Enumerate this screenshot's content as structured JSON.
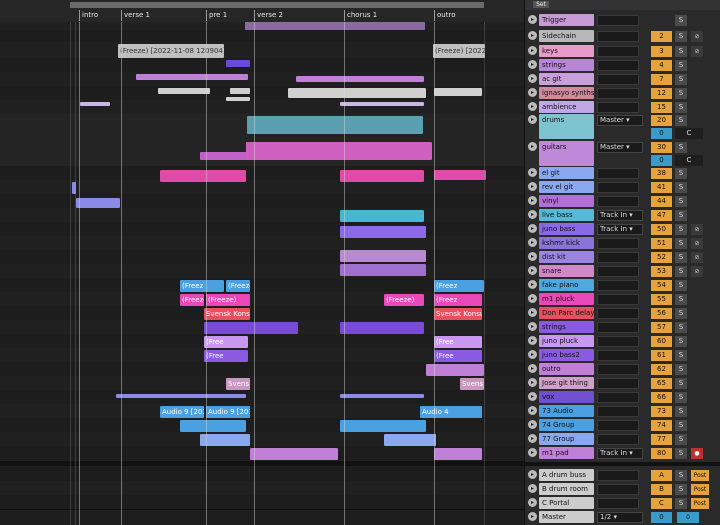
{
  "locators": [
    {
      "label": "intro"
    },
    {
      "label": "verse 1"
    },
    {
      "label": "pre 1"
    },
    {
      "label": "verse 2"
    },
    {
      "label": "chorus 1"
    },
    {
      "label": "outro"
    }
  ],
  "clip_labels": {
    "keys_freeze": "(Freeze) [2022-11-08 120904]",
    "keys_freeze2": "(Freeze) [2022",
    "freeze_a": "(Freez",
    "freeze_b": "(Freeze)",
    "freeze_c": "(Freez",
    "freeze_d": "(Freeze)",
    "freeze_e": "(Freeze)",
    "freeze_f": "(Freez",
    "svensk1": "Svensk Konsult",
    "svensk2": "Svensk Konsult",
    "freeze_g": "(Free",
    "freeze_h": "(Free",
    "freeze_i": "(Free",
    "freeze_j": "(Free",
    "svens": "Svens",
    "svens2": "Svens",
    "audio9a": "Audio 9 [2022",
    "audio9b": "Audio 9 [2022",
    "audio4": "Audio 4"
  },
  "mixer": {
    "set_label": "Set",
    "tracks": [
      {
        "name": "Trigger",
        "num": "",
        "color": "#c89ad6",
        "solo": "S",
        "extra": ""
      },
      {
        "name": "Sidechain",
        "num": "2",
        "color": "#b8b8b8",
        "solo": "S",
        "extra": "⊘"
      },
      {
        "name": "keys",
        "num": "3",
        "color": "#e89ac8",
        "solo": "S",
        "extra": "⊘"
      },
      {
        "name": "strings",
        "num": "4",
        "color": "#b886d8",
        "solo": "S",
        "extra": ""
      },
      {
        "name": "ac git",
        "num": "7",
        "color": "#c9a0dc",
        "solo": "S",
        "extra": ""
      },
      {
        "name": "ignasyo synths",
        "num": "12",
        "color": "#d08aa0",
        "solo": "S",
        "extra": ""
      },
      {
        "name": "ambience",
        "num": "15",
        "color": "#c0a8e8",
        "solo": "S",
        "extra": ""
      },
      {
        "name": "drums",
        "num": "20",
        "color": "#7ec4d0",
        "solo": "S",
        "extra": "",
        "route": "Master"
      },
      {
        "name": "guitars",
        "num": "30",
        "color": "#c088d8",
        "solo": "S",
        "extra": "",
        "route": "Master"
      },
      {
        "name": "el git",
        "num": "38",
        "color": "#8aa8f0",
        "solo": "S",
        "extra": ""
      },
      {
        "name": "rev el git",
        "num": "41",
        "color": "#8aa8f0",
        "solo": "S",
        "extra": ""
      },
      {
        "name": "vinyl",
        "num": "44",
        "color": "#b070d8",
        "solo": "S",
        "extra": ""
      },
      {
        "name": "live bass",
        "num": "47",
        "color": "#58b8d8",
        "solo": "S",
        "extra": "",
        "route": "Track In"
      },
      {
        "name": "juno bass",
        "num": "50",
        "color": "#8a6ae8",
        "solo": "S",
        "extra": "⊘",
        "route": "Track In"
      },
      {
        "name": "kshmr kick",
        "num": "51",
        "color": "#8a74d8",
        "solo": "S",
        "extra": "⊘"
      },
      {
        "name": "dist kit",
        "num": "52",
        "color": "#9a86e0",
        "solo": "S",
        "extra": "⊘"
      },
      {
        "name": "snare",
        "num": "53",
        "color": "#d088c8",
        "solo": "S",
        "extra": "⊘"
      },
      {
        "name": "fake piano",
        "num": "54",
        "color": "#50a8e0",
        "solo": "S",
        "extra": ""
      },
      {
        "name": "m1 pluck",
        "num": "55",
        "color": "#e848b8",
        "solo": "S",
        "extra": ""
      },
      {
        "name": "Don Parc delay",
        "num": "56",
        "color": "#e85060",
        "solo": "S",
        "extra": ""
      },
      {
        "name": "strings",
        "num": "57",
        "color": "#8a5ae0",
        "solo": "S",
        "extra": ""
      },
      {
        "name": "juno pluck",
        "num": "60",
        "color": "#c898f0",
        "solo": "S",
        "extra": ""
      },
      {
        "name": "juno bass2",
        "num": "61",
        "color": "#8a5ae0",
        "solo": "S",
        "extra": ""
      },
      {
        "name": "outro",
        "num": "62",
        "color": "#c080d8",
        "solo": "S",
        "extra": ""
      },
      {
        "name": "Jose git thing",
        "num": "65",
        "color": "#d0a0c8",
        "solo": "S",
        "extra": ""
      },
      {
        "name": "vox",
        "num": "66",
        "color": "#7050d0",
        "solo": "S",
        "extra": ""
      },
      {
        "name": "73 Audio",
        "num": "73",
        "color": "#4aa0e0",
        "solo": "S",
        "extra": ""
      },
      {
        "name": "74 Group",
        "num": "74",
        "color": "#4aa0e0",
        "solo": "S",
        "extra": ""
      },
      {
        "name": "77 Group",
        "num": "77",
        "color": "#8aa8f0",
        "solo": "S",
        "extra": ""
      },
      {
        "name": "m1 pad",
        "num": "80",
        "color": "#c080d8",
        "solo": "S",
        "extra": "●",
        "route": "Track In"
      }
    ],
    "returns": [
      {
        "name": "A drum buss",
        "num": "A",
        "post": "Post"
      },
      {
        "name": "B drum room",
        "num": "B",
        "post": "Post"
      },
      {
        "name": "C Portal",
        "num": "C",
        "post": "Post"
      }
    ],
    "master": {
      "name": "Master",
      "route": "1/2",
      "num": "0",
      "cue": "0"
    },
    "sub_values": {
      "drums": "0",
      "drums_c": "C",
      "guitars": "0",
      "guitars_c": "C"
    }
  }
}
